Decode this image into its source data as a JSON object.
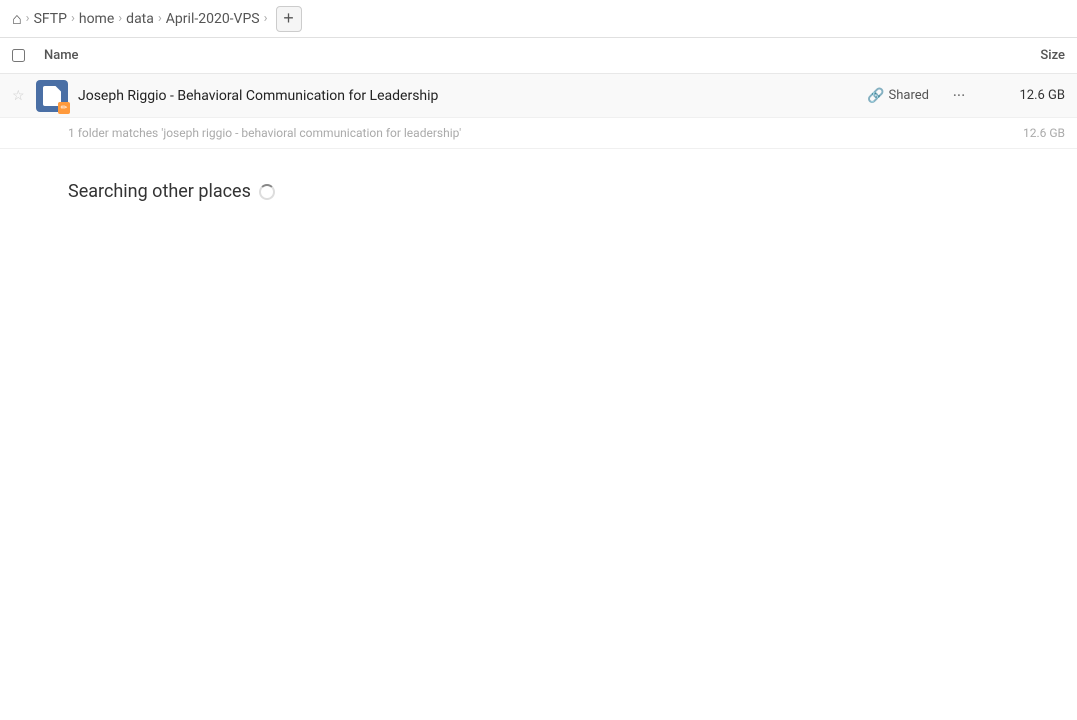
{
  "toolbar": {
    "home_label": "🏠",
    "breadcrumbs": [
      {
        "id": "sftp",
        "label": "SFTP"
      },
      {
        "id": "home",
        "label": "home"
      },
      {
        "id": "data",
        "label": "data"
      },
      {
        "id": "april-2020-vps",
        "label": "April-2020-VPS"
      }
    ],
    "add_button_label": "+"
  },
  "columns": {
    "name_label": "Name",
    "size_label": "Size"
  },
  "file_row": {
    "name": "Joseph Riggio - Behavioral Communication for Leadership",
    "shared_label": "Shared",
    "size": "12.6 GB",
    "more_label": "···"
  },
  "match_info": {
    "text": "1 folder matches 'joseph riggio - behavioral communication for leadership'",
    "size": "12.6 GB"
  },
  "searching_section": {
    "label": "Searching other places"
  },
  "icons": {
    "star": "☆",
    "link": "🔗",
    "more": "···",
    "spinner_alt": "loading"
  }
}
